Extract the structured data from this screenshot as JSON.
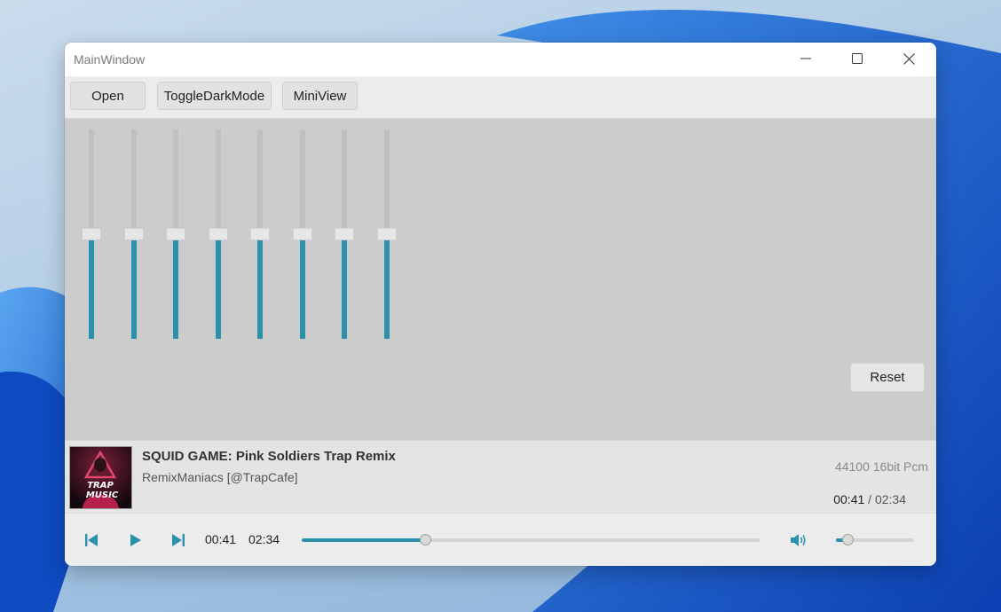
{
  "window": {
    "title": "MainWindow"
  },
  "toolbar": {
    "open_label": "Open",
    "toggle_dark_label": "ToggleDarkMode",
    "miniview_label": "MiniView"
  },
  "equalizer": {
    "bands": [
      {
        "level": 0.5
      },
      {
        "level": 0.5
      },
      {
        "level": 0.5
      },
      {
        "level": 0.5
      },
      {
        "level": 0.5
      },
      {
        "level": 0.5
      },
      {
        "level": 0.5
      },
      {
        "level": 0.5
      }
    ],
    "reset_label": "Reset"
  },
  "now_playing": {
    "title": "SQUID GAME: Pink Soldiers Trap Remix",
    "artist": "RemixManiacs [@TrapCafe]",
    "album_art_text": "TRAP MUSIC",
    "format": "44100 16bit Pcm",
    "current_time": "00:41",
    "separator": "/",
    "total_time": "02:34"
  },
  "transport": {
    "current_time": "00:41",
    "total_time": "02:34",
    "progress": 0.27,
    "volume": 0.15
  },
  "colors": {
    "accent": "#2a91ad"
  },
  "icons": {
    "minimize": "minimize-icon",
    "maximize": "maximize-icon",
    "close": "close-icon",
    "previous": "skip-previous-icon",
    "play": "play-icon",
    "next": "skip-next-icon",
    "volume": "volume-icon"
  }
}
